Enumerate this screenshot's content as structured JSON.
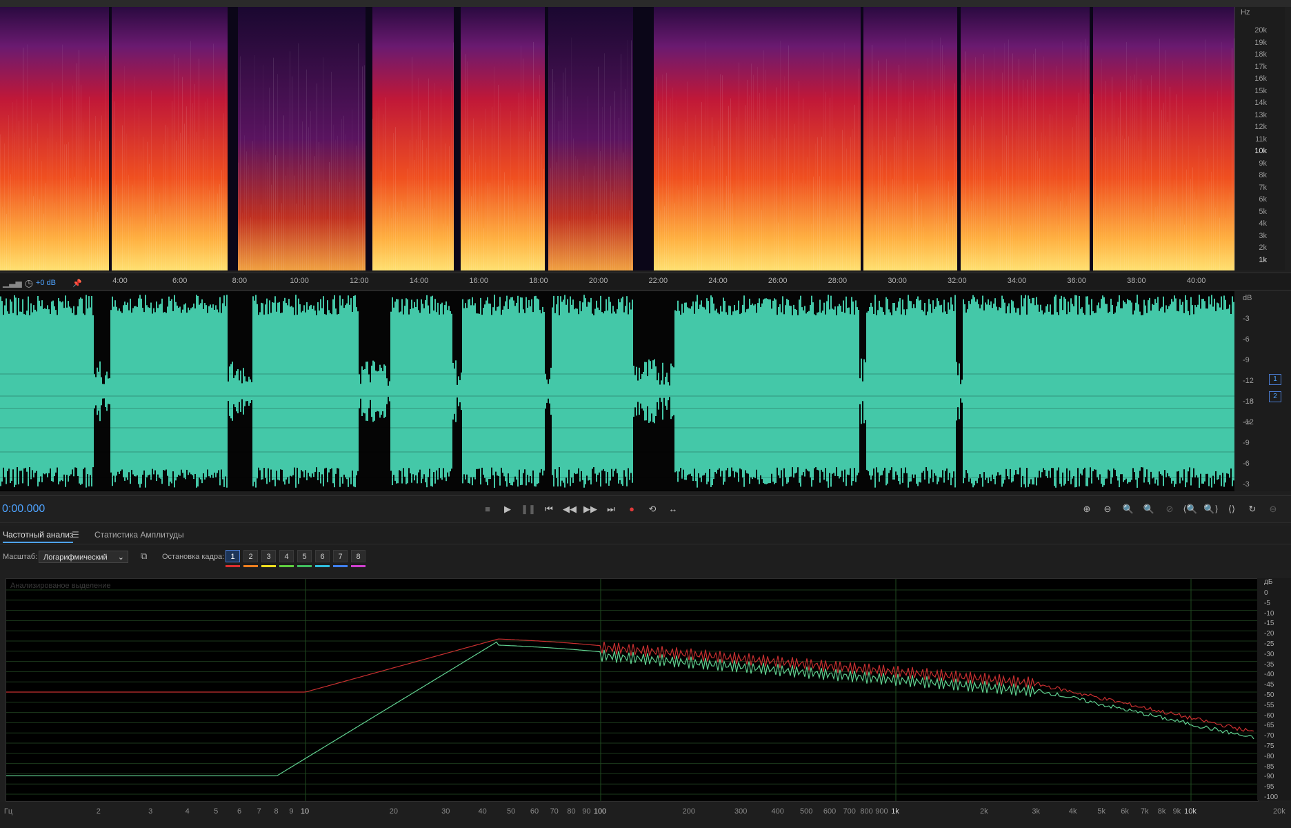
{
  "spectrogram": {
    "unit": "Hz",
    "labels": [
      "20k",
      "19k",
      "18k",
      "17k",
      "16k",
      "15k",
      "14k",
      "13k",
      "12k",
      "11k",
      "10k",
      "9k",
      "8k",
      "7k",
      "6k",
      "5k",
      "4k",
      "3k",
      "2k",
      "1k"
    ]
  },
  "timeline": {
    "gain_label": "+0 dB",
    "ticks": [
      "4:00",
      "6:00",
      "8:00",
      "10:00",
      "12:00",
      "14:00",
      "16:00",
      "18:00",
      "20:00",
      "22:00",
      "24:00",
      "26:00",
      "28:00",
      "30:00",
      "32:00",
      "34:00",
      "36:00",
      "38:00",
      "40:00"
    ]
  },
  "waveform": {
    "unit": "dB",
    "labels_top": [
      "-3",
      "-6",
      "-9",
      "-12",
      "-18",
      "-∞"
    ],
    "labels_bottom": [
      "-18",
      "-12",
      "-9",
      "-6",
      "-3"
    ],
    "channels": [
      "1",
      "2"
    ],
    "color": "#44c8a8"
  },
  "transport": {
    "time": "0:00.000"
  },
  "panel": {
    "tabs": [
      "Частотный анализ",
      "Статистика Амплитуды"
    ],
    "scale_label": "Масштаб:",
    "scale_value": "Логарифмический",
    "freeze_label": "Остановка кадра:",
    "frames": [
      "1",
      "2",
      "3",
      "4",
      "5",
      "6",
      "7",
      "8"
    ],
    "frame_colors": [
      "#e03030",
      "#f08020",
      "#f0e020",
      "#60d040",
      "#40c060",
      "#30c0e0",
      "#4080f0",
      "#d040d0"
    ],
    "analyzed_label": "Анализированое выделение"
  },
  "freq_db": {
    "unit": "дБ",
    "labels": [
      "0",
      "-5",
      "-10",
      "-15",
      "-20",
      "-25",
      "-30",
      "-35",
      "-40",
      "-45",
      "-50",
      "-55",
      "-60",
      "-65",
      "-70",
      "-75",
      "-80",
      "-85",
      "-90",
      "-95",
      "-100"
    ]
  },
  "freq_axis": {
    "unit": "Гц",
    "labels": [
      "2",
      "3",
      "4",
      "5",
      "6",
      "7",
      "8",
      "9",
      "10",
      "20",
      "30",
      "40",
      "50",
      "60",
      "70",
      "80",
      "90",
      "100",
      "200",
      "300",
      "400",
      "500",
      "600",
      "700",
      "800",
      "900",
      "1k",
      "2k",
      "3k",
      "4k",
      "5k",
      "6k",
      "7k",
      "8k",
      "9k",
      "10k",
      "20k"
    ],
    "major": [
      "10",
      "100",
      "1k",
      "10k"
    ]
  },
  "colors": {
    "curve_red": "#c83030",
    "curve_green": "#60d090",
    "accent": "#4ea3ff"
  }
}
